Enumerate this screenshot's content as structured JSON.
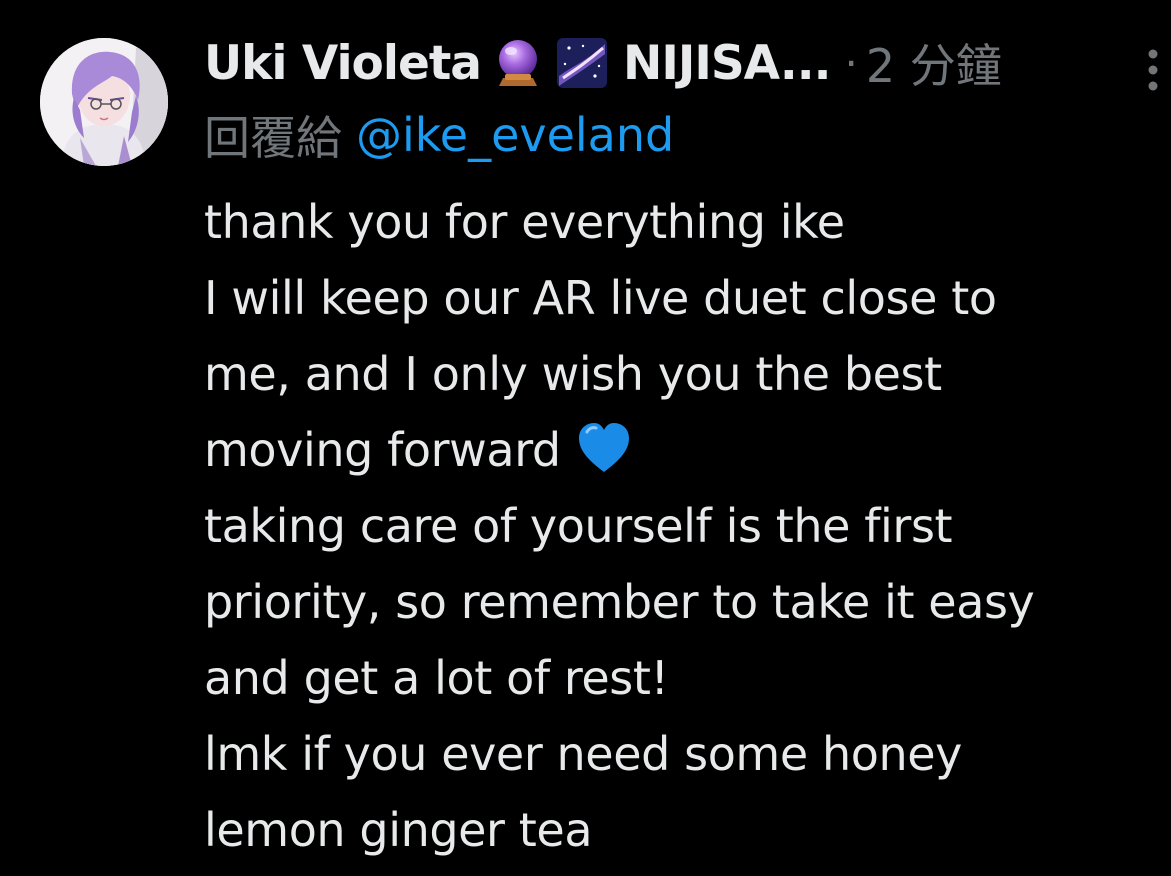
{
  "tweet": {
    "display_name": "Uki Violeta",
    "name_emojis": [
      "crystal-ball-icon",
      "milky-way-icon"
    ],
    "name_suffix": "NIJISA...",
    "separator": "·",
    "timestamp": "2 分鐘",
    "reply_prefix": "回覆給",
    "reply_to": "@ike_eveland",
    "lines": [
      "thank you for everything ike",
      "I will keep our AR live duet close to",
      "me, and I only wish you the best",
      "moving forward",
      "taking care of yourself is the first",
      "priority, so remember to take it easy",
      "and get a lot of rest!",
      "lmk if you ever need some honey",
      "lemon ginger tea"
    ],
    "line_emoji": "blue-heart-icon"
  },
  "colors": {
    "background": "#000000",
    "text_primary": "#e7e9ea",
    "text_secondary": "#71767b",
    "link": "#1d9bf0",
    "heart": "#1a8ce8"
  }
}
